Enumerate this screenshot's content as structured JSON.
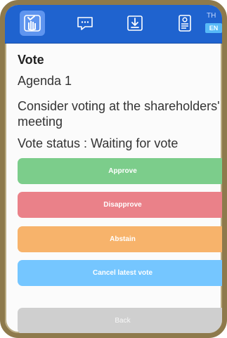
{
  "toolbar": {
    "language": {
      "th": "TH",
      "en": "EN"
    }
  },
  "vote": {
    "title": "Vote",
    "agenda": "Agenda 1",
    "description": "Consider voting at the shareholders' meeting",
    "status": "Vote status : Waiting for vote"
  },
  "actions": {
    "approve": "Approve",
    "disapprove": "Disapprove",
    "abstain": "Abstain",
    "cancel": "Cancel latest vote",
    "back": "Back"
  }
}
